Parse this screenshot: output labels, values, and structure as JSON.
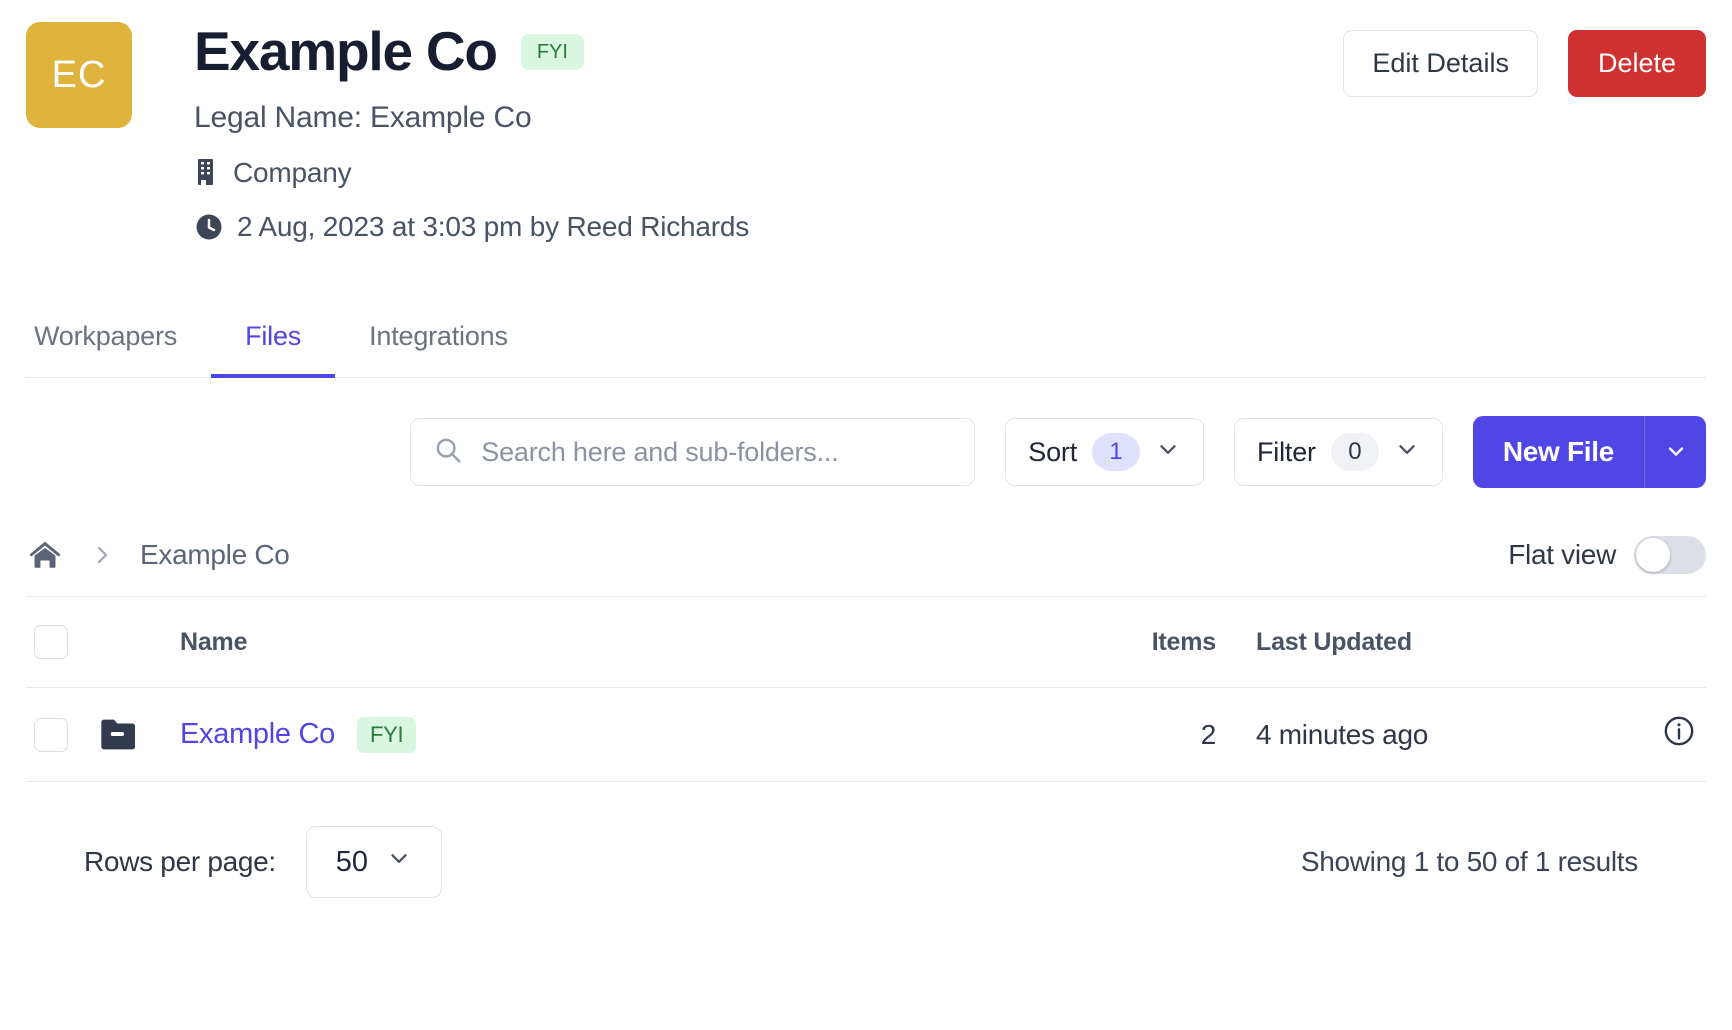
{
  "header": {
    "avatar_initials": "EC",
    "title": "Example Co",
    "title_badge": "FYI",
    "legal_name": "Legal Name: Example Co",
    "entity_type": "Company",
    "timestamp": "2 Aug, 2023 at 3:03 pm by Reed Richards",
    "edit_label": "Edit Details",
    "delete_label": "Delete",
    "accent_avatar": "#e0b33c",
    "accent_delete": "#cf3230"
  },
  "tabs": [
    {
      "label": "Workpapers",
      "active": false
    },
    {
      "label": "Files",
      "active": true
    },
    {
      "label": "Integrations",
      "active": false
    }
  ],
  "toolbar": {
    "search_placeholder": "Search here and sub-folders...",
    "search_value": "",
    "sort_label": "Sort",
    "sort_count": "1",
    "filter_label": "Filter",
    "filter_count": "0",
    "new_file_label": "New File",
    "accent": "#4f46e5"
  },
  "breadcrumb": {
    "home_icon": "home-icon",
    "separator": "chevron-right-icon",
    "current": "Example Co",
    "flat_view_label": "Flat view",
    "flat_view_on": false
  },
  "table": {
    "columns": [
      "Name",
      "Items",
      "Last Updated"
    ],
    "rows": [
      {
        "name": "Example Co",
        "badge": "FYI",
        "items": "2",
        "last_updated": "4 minutes ago",
        "icon": "folder-icon",
        "selected": false
      }
    ]
  },
  "footer": {
    "rows_per_page_label": "Rows per page:",
    "rows_per_page_value": "50",
    "showing": "Showing 1 to 50 of 1 results"
  }
}
